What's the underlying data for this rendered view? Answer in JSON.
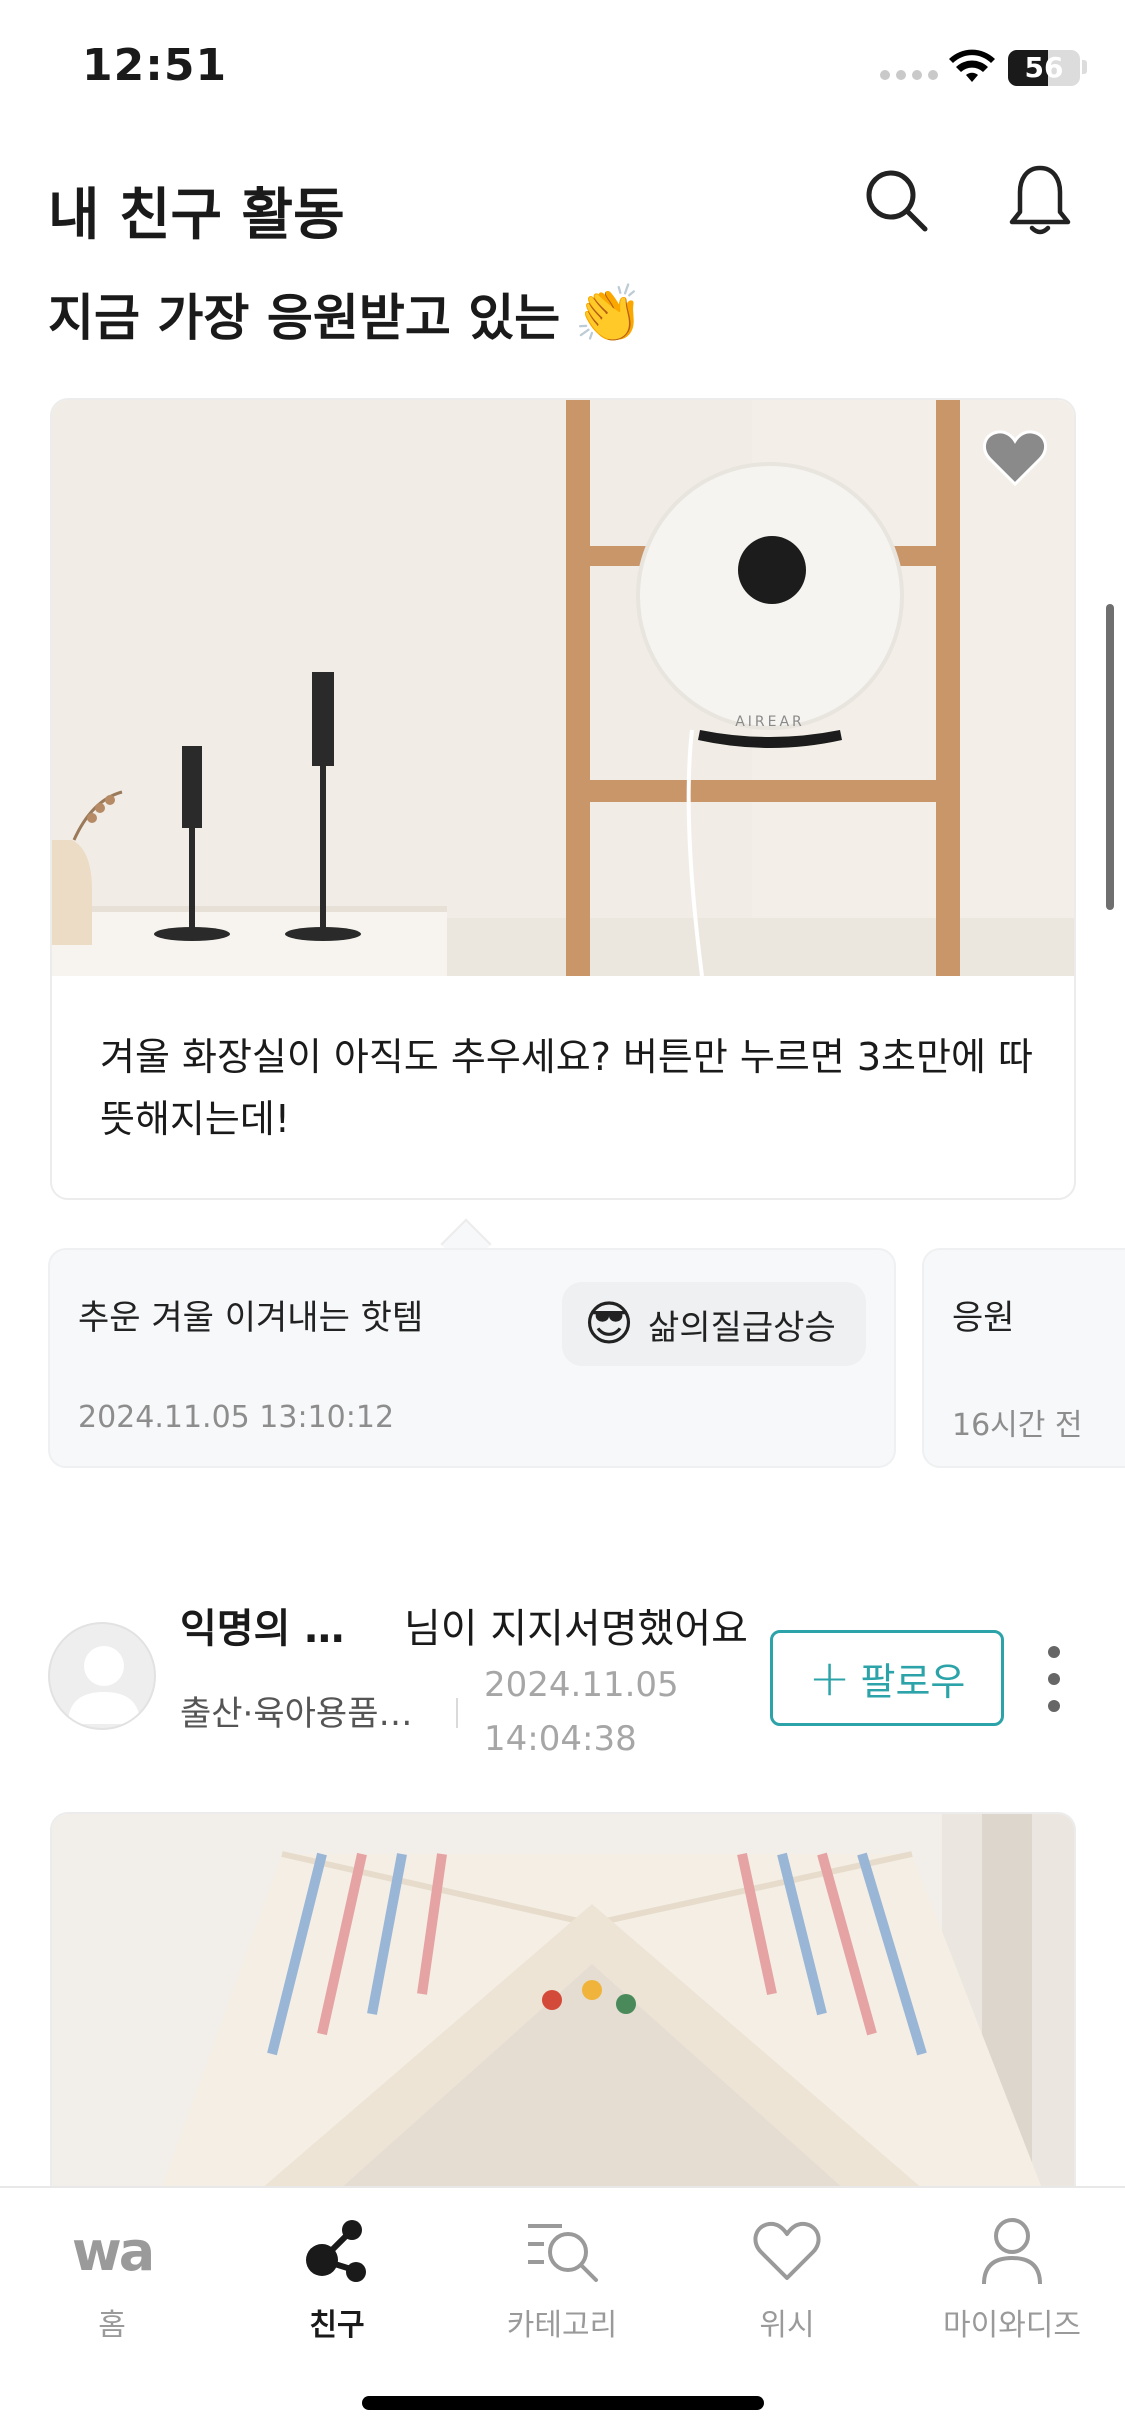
{
  "status_bar": {
    "time": "12:51",
    "battery": "56",
    "battery_level_percent": 56
  },
  "header": {
    "title": "내 친구 활동",
    "search_icon": "search-icon",
    "notification_icon": "bell-icon"
  },
  "featured_section": {
    "title": "지금 가장 응원받고 있는",
    "title_emoji": "👏",
    "card": {
      "image_brand_text": "AIREAR",
      "text": "겨울 화장실이 아직도 추우세요? 버튼만 누르면 3초만에 따뜻해지는데!",
      "wish_icon": "heart-icon"
    },
    "comments": [
      {
        "text": "추운 겨울 이겨내는 핫템",
        "reaction_emoji": "😎",
        "reaction_label": "삶의질급상승",
        "date": "2024.11.05 13:10:12"
      },
      {
        "text": "응원",
        "date": "16시간 전"
      }
    ]
  },
  "activity": {
    "user_name": "익명의 서...",
    "action": "님이 지지서명했어요",
    "category": "출산·육아용품 ...",
    "date": "2024.11.05 14:04:38",
    "follow_label": "팔로우",
    "follow_plus": "+"
  },
  "tab_bar": {
    "items": [
      {
        "label": "홈",
        "icon": "wa-logo-icon",
        "logo_text": "wa",
        "active": false
      },
      {
        "label": "친구",
        "icon": "friends-network-icon",
        "active": true
      },
      {
        "label": "카테고리",
        "icon": "category-search-icon",
        "active": false
      },
      {
        "label": "위시",
        "icon": "heart-icon",
        "active": false
      },
      {
        "label": "마이와디즈",
        "icon": "user-icon",
        "active": false
      }
    ]
  },
  "colors": {
    "accent": "#2ba3a8",
    "text_primary": "#1a1a1a",
    "text_muted": "#8d8d8d",
    "card_background": "#f7f8fa"
  }
}
